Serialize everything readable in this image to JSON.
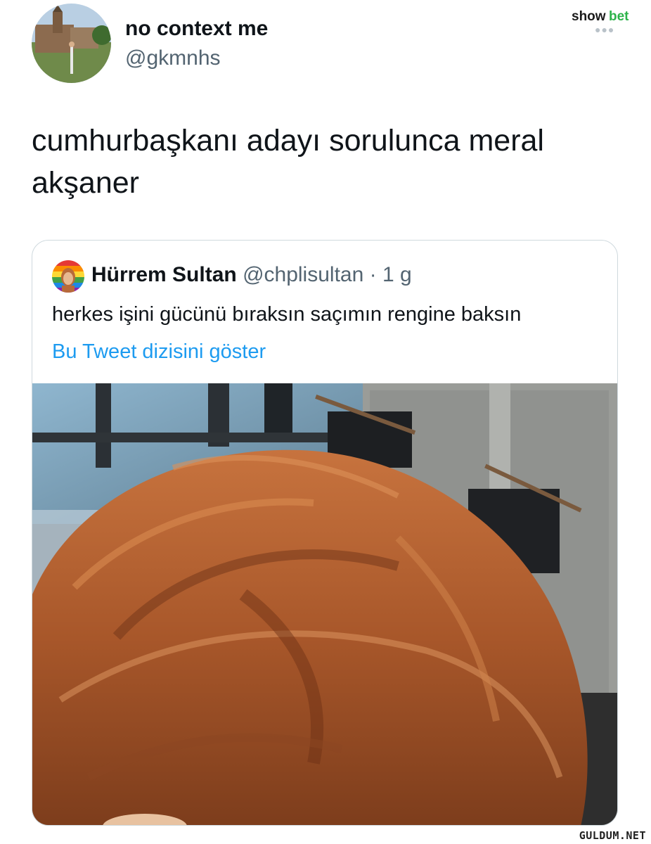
{
  "brand": {
    "watermark_logo": "showbet",
    "site_watermark": "GULDUM.NET"
  },
  "tweet": {
    "display_name": "no context me",
    "handle": "@gkmnhs",
    "text": "cumhurbaşkanı adayı sorulunca meral akşaner"
  },
  "quoted_tweet": {
    "display_name": "Hürrem Sultan",
    "handle": "@chplisultan",
    "separator": " · ",
    "time": "1 g",
    "text": "herkes işini gücünü bıraksın saçımın rengine baksın",
    "thread_link": "Bu Tweet dizisini göster"
  },
  "colors": {
    "text_primary": "#0f1419",
    "text_secondary": "#536471",
    "link": "#1d9bf0",
    "card_border": "#cfd9de"
  }
}
